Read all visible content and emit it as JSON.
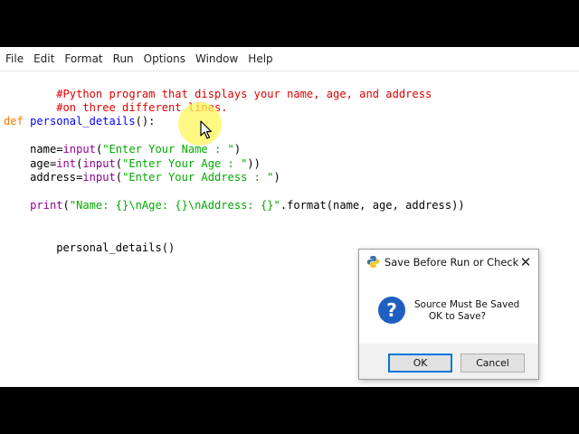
{
  "menubar": {
    "items": [
      "File",
      "Edit",
      "Format",
      "Run",
      "Options",
      "Window",
      "Help"
    ]
  },
  "editor": {
    "line1": "#Python program that displays your name, age, and address",
    "line2": "#on three different lines.",
    "line3_kw": "def",
    "line3_name": " personal_details",
    "line3_rest": "():",
    "line4_a": "    name=",
    "line4_b": "input",
    "line4_c": "(",
    "line4_d": "\"Enter Your Name : \"",
    "line4_e": ")",
    "line5_a": "    age=",
    "line5_b": "int",
    "line5_c": "(",
    "line5_d": "input",
    "line5_e": "(",
    "line5_f": "\"Enter Your Age : \"",
    "line5_g": "))",
    "line6_a": "    address=",
    "line6_b": "input",
    "line6_c": "(",
    "line6_d": "\"Enter Your Address : \"",
    "line6_e": ")",
    "line7_a": "    ",
    "line7_b": "print",
    "line7_c": "(",
    "line7_d": "\"Name: {}\\nAge: {}\\nAddress: {}\"",
    "line7_e": ".format(name, age, address))",
    "line8": "personal_details()"
  },
  "dialog": {
    "title": "Save Before Run or Check",
    "close_glyph": "✕",
    "question_glyph": "?",
    "message_line1": "Source Must Be Saved",
    "message_line2": "OK to Save?",
    "ok_label": "OK",
    "cancel_label": "Cancel"
  },
  "colors": {
    "comment": "#dd0000",
    "keyword": "#ff7700",
    "definition": "#0000ff",
    "builtin": "#900090",
    "string": "#00aa00",
    "focus_border": "#0078d7"
  },
  "icons": {
    "dialog_app_icon": "python-icon",
    "dialog_question_icon": "question-icon",
    "pointer": "mouse-cursor-icon",
    "close": "close-icon"
  }
}
